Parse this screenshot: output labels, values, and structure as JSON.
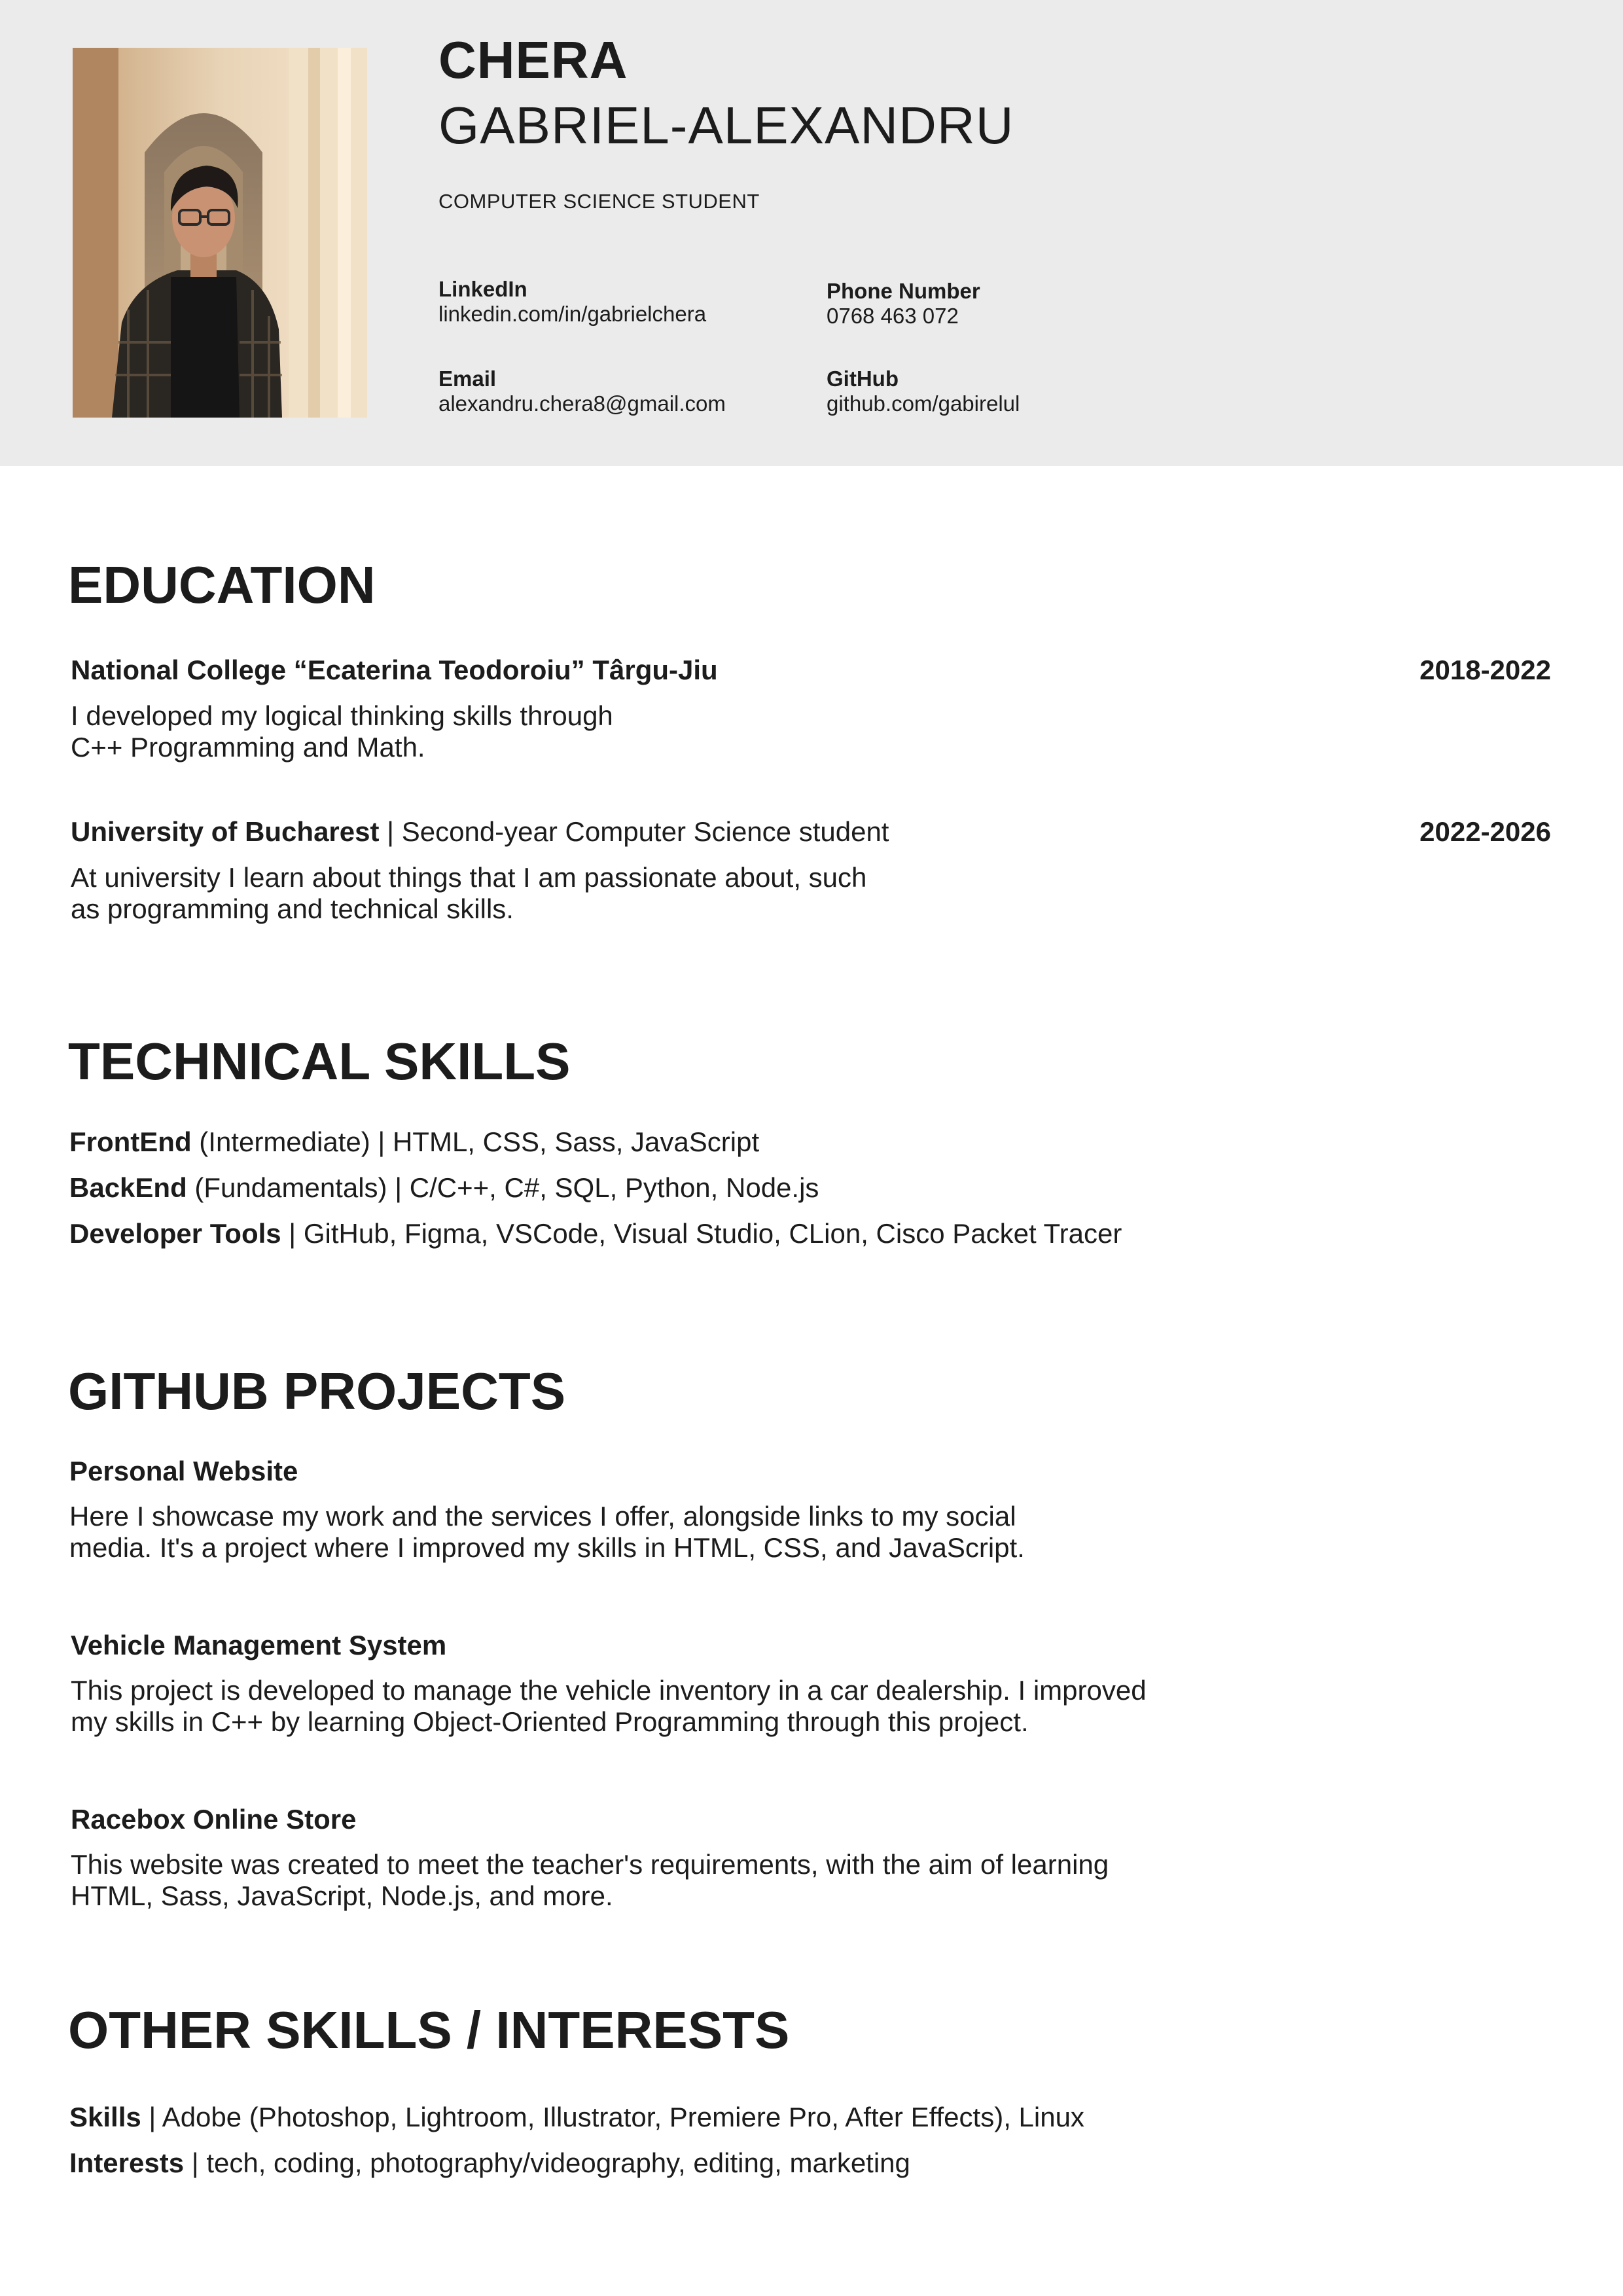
{
  "header": {
    "last_name": "CHERA",
    "first_name": "GABRIEL-ALEXANDRU",
    "role": "COMPUTER SCIENCE STUDENT",
    "contacts": [
      {
        "label": "LinkedIn",
        "value": "linkedin.com/in/gabrielchera"
      },
      {
        "label": "Phone Number",
        "value": "0768 463 072"
      },
      {
        "label": "Email",
        "value": "alexandru.chera8@gmail.com"
      },
      {
        "label": "GitHub",
        "value": "github.com/gabirelul"
      }
    ]
  },
  "education": {
    "title": "EDUCATION",
    "entries": [
      {
        "institution": "National College “Ecaterina Teodoroiu” Târgu-Jiu",
        "detail": "",
        "years": "2018-2022",
        "desc_line1": "I developed my logical thinking skills through",
        "desc_line2": "C++ Programming and Math."
      },
      {
        "institution": "University of Bucharest",
        "detail": " | Second-year Computer Science student",
        "years": "2022-2026",
        "desc_line1": "At university I learn about things that I am passionate about, such",
        "desc_line2": "as programming and technical skills."
      }
    ]
  },
  "technical_skills": {
    "title": "TECHNICAL SKILLS",
    "lines": [
      {
        "label": "FrontEnd",
        "text": " (Intermediate) | HTML, CSS, Sass, JavaScript"
      },
      {
        "label": "BackEnd",
        "text": " (Fundamentals) | C/C++, C#, SQL, Python, Node.js"
      },
      {
        "label": "Developer Tools",
        "text": " | GitHub, Figma, VSCode, Visual Studio, CLion, Cisco Packet Tracer"
      }
    ]
  },
  "projects": {
    "title": "GITHUB PROJECTS",
    "items": [
      {
        "name": "Personal Website",
        "line1": "Here I showcase my work and the services I offer, alongside links to my social",
        "line2": "media. It's a project where I improved my skills in HTML, CSS, and JavaScript."
      },
      {
        "name": "Vehicle Management System",
        "line1": "This project is developed to manage the vehicle inventory in a car dealership. I improved",
        "line2": "my skills in C++ by learning Object-Oriented Programming through this project."
      },
      {
        "name": "Racebox Online Store",
        "line1": "This website was created to meet the teacher's requirements, with the aim of learning",
        "line2": "HTML, Sass, JavaScript, Node.js, and more."
      }
    ]
  },
  "other": {
    "title": "OTHER SKILLS / INTERESTS",
    "lines": [
      {
        "label": "Skills",
        "text": " | Adobe (Photoshop, Lightroom, Illustrator, Premiere Pro, After Effects), Linux"
      },
      {
        "label": "Interests",
        "text": " | tech, coding, photography/videography, editing, marketing"
      }
    ]
  }
}
